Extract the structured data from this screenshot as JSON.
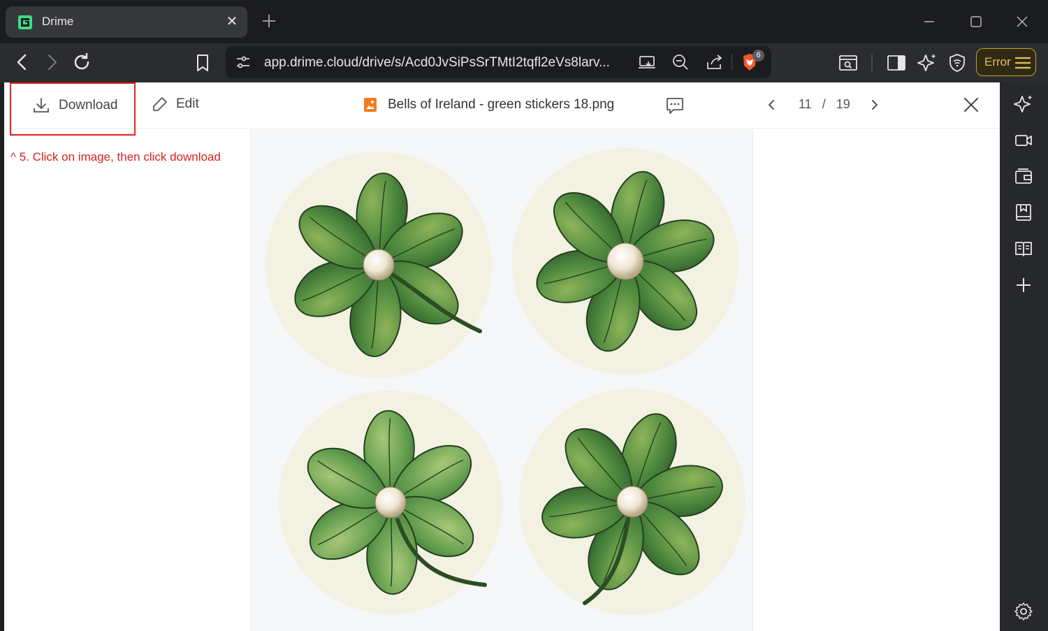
{
  "browser": {
    "tab": {
      "title": "Drime",
      "close": "✕"
    },
    "address_bar": {
      "url": "app.drime.cloud/drive/s/Acd0JvSiPsSrTMtI2tqfl2eVs8larv..."
    },
    "brave_shield_count": "6",
    "error_button": {
      "label": "Error"
    }
  },
  "viewer": {
    "toolbar": {
      "download_label": "Download",
      "edit_label": "Edit",
      "file_name": "Bells of Ireland - green stickers 18.png",
      "current_page": "11",
      "separator": "/",
      "total_pages": "19"
    },
    "instruction": "^ 5. Click on image, then click download"
  },
  "colors": {
    "accent_red": "#e3221e",
    "brave_orange": "#f15a24",
    "error_gold": "#e8c14a",
    "drime_green": "#3ddc84"
  },
  "icons": {
    "tab": [
      "drime-logo-icon",
      "close-icon",
      "plus-icon"
    ],
    "window": [
      "minimize-icon",
      "maximize-icon",
      "close-icon"
    ],
    "toolbar": [
      "back-icon",
      "forward-icon",
      "reload-icon",
      "bookmark-icon",
      "site-settings-icon",
      "cast-icon",
      "zoom-icon",
      "share-icon",
      "brave-shield-icon",
      "reader-mode-icon",
      "sidebar-toggle-icon",
      "leo-ai-icon",
      "vpn-shield-icon",
      "hamburger-icon"
    ],
    "viewer": [
      "download-icon",
      "pencil-icon",
      "image-file-icon",
      "comment-icon",
      "chevron-left-icon",
      "chevron-right-icon",
      "close-icon"
    ],
    "sidebar": [
      "leo-ai-icon",
      "video-call-icon",
      "wallet-icon",
      "bookmarks-icon",
      "reading-list-icon",
      "plus-icon",
      "settings-icon"
    ]
  }
}
